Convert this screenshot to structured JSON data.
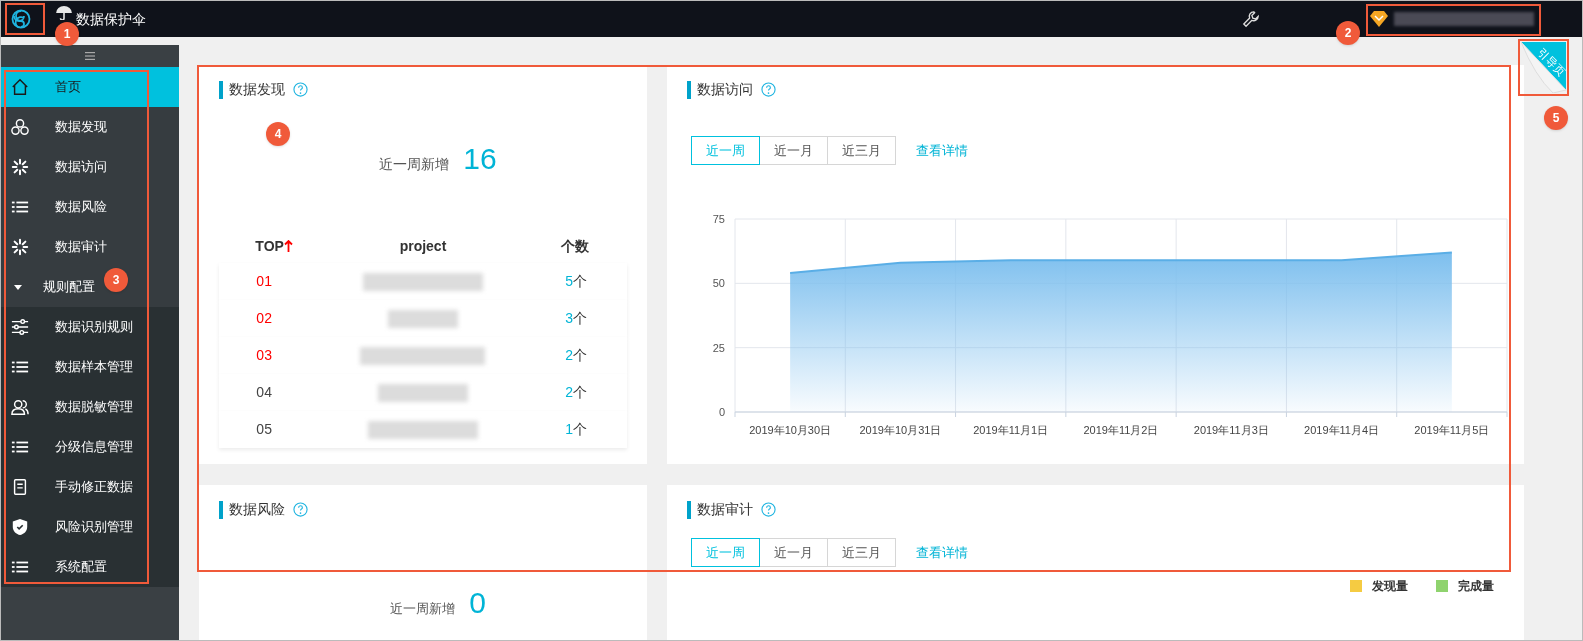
{
  "top_bar": {
    "title": "数据保护伞"
  },
  "guide_tab": {
    "label": "引导页"
  },
  "sidebar": {
    "items": [
      {
        "label": "首页",
        "selected": true
      },
      {
        "label": "数据发现",
        "selected": false
      },
      {
        "label": "数据访问",
        "selected": false
      },
      {
        "label": "数据风险",
        "selected": false
      },
      {
        "label": "数据审计",
        "selected": false
      },
      {
        "label": "规则配置",
        "selected": false,
        "expanded": true,
        "children": [
          {
            "label": "数据识别规则",
            "selected": false
          },
          {
            "label": "数据样本管理",
            "selected": false
          },
          {
            "label": "数据脱敏管理",
            "selected": false
          },
          {
            "label": "分级信息管理",
            "selected": false
          },
          {
            "label": "手动修正数据",
            "selected": false
          },
          {
            "label": "风险识别管理",
            "selected": false
          },
          {
            "label": "系统配置",
            "selected": false
          }
        ]
      }
    ]
  },
  "discovery": {
    "title": "数据发现",
    "stat_label": "近一周新增",
    "stat_value": "16",
    "columns": [
      "TOP",
      "project",
      "个数"
    ],
    "rows": [
      {
        "rank": "01",
        "top": true,
        "count": "5",
        "unit": "个"
      },
      {
        "rank": "02",
        "top": true,
        "count": "3",
        "unit": "个"
      },
      {
        "rank": "03",
        "top": true,
        "count": "2",
        "unit": "个"
      },
      {
        "rank": "04",
        "top": false,
        "count": "2",
        "unit": "个"
      },
      {
        "rank": "05",
        "top": false,
        "count": "1",
        "unit": "个"
      }
    ]
  },
  "access": {
    "title": "数据访问",
    "ranges": [
      {
        "label": "近一周",
        "selected": true
      },
      {
        "label": "近一月",
        "selected": false
      },
      {
        "label": "近三月",
        "selected": false
      }
    ],
    "link": "查看详情",
    "chart_data": {
      "type": "area",
      "categories": [
        "2019年10月30日",
        "2019年10月31日",
        "2019年11月1日",
        "2019年11月2日",
        "2019年11月3日",
        "2019年11月4日",
        "2019年11月5日"
      ],
      "series": [
        {
          "color": "#5aaee6",
          "values": [
            54,
            58,
            59,
            59,
            59,
            59,
            62
          ]
        }
      ],
      "ylim": [
        0,
        75
      ],
      "yticks": [
        0,
        25,
        50,
        75
      ]
    }
  },
  "risk": {
    "title": "数据风险",
    "stat_label": "近一周新增",
    "stat_value": "0"
  },
  "audit": {
    "title": "数据审计",
    "ranges": [
      {
        "label": "近一周",
        "selected": true
      },
      {
        "label": "近一月",
        "selected": false
      },
      {
        "label": "近三月",
        "selected": false
      }
    ],
    "link": "查看详情",
    "legend": [
      {
        "label": "发现量",
        "color": "#f5cb42"
      },
      {
        "label": "完成量",
        "color": "#8fd36e"
      }
    ]
  },
  "callouts": [
    "1",
    "2",
    "3",
    "4",
    "5"
  ]
}
